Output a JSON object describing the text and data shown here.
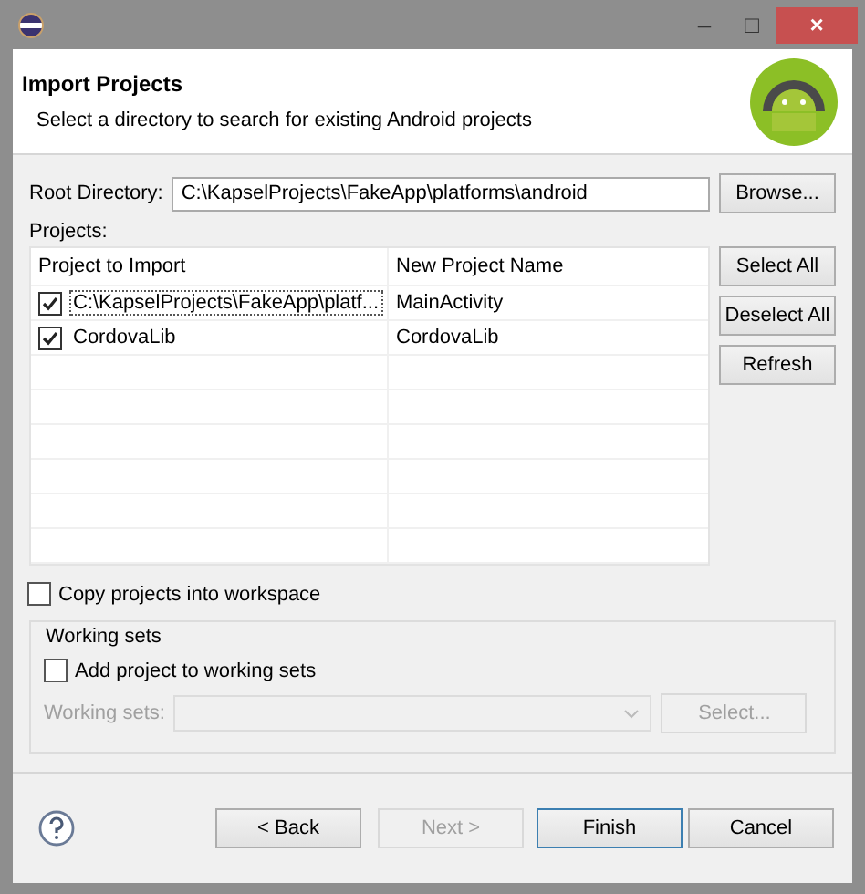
{
  "window": {
    "title_buttons": [
      "–",
      "□",
      "×"
    ]
  },
  "header": {
    "title": "Import Projects",
    "description": "Select a directory to search for existing Android projects"
  },
  "root_directory": {
    "label": "Root Directory:",
    "value": "C:\\KapselProjects\\FakeApp\\platforms\\android",
    "button": "Browse..."
  },
  "projects": {
    "label": "Projects:",
    "columns": [
      "Project to Import",
      "New Project Name"
    ],
    "rows": [
      {
        "project": "C:\\KapselProjects\\FakeApp\\platf...",
        "name": "MainActivity",
        "checked": true,
        "focused": true
      },
      {
        "project": "CordovaLib",
        "name": "CordovaLib",
        "checked": true,
        "focused": false
      }
    ],
    "buttons": [
      "Select All",
      "Deselect All",
      "Refresh"
    ]
  },
  "copy_option": {
    "label": "Copy projects into workspace",
    "checked": false
  },
  "working_sets": {
    "title": "Working sets",
    "add_option": {
      "label": "Add project to working sets",
      "checked": false
    },
    "combo_label": "Working sets:",
    "disabled": true,
    "select_button": "Select..."
  },
  "footer": {
    "buttons": [
      {
        "label": "< Back",
        "disabled": false,
        "default": false
      },
      {
        "label": "Next >",
        "disabled": true,
        "default": false
      },
      {
        "label": "Finish",
        "disabled": false,
        "default": true
      },
      {
        "label": "Cancel",
        "disabled": false,
        "default": false
      }
    ]
  }
}
